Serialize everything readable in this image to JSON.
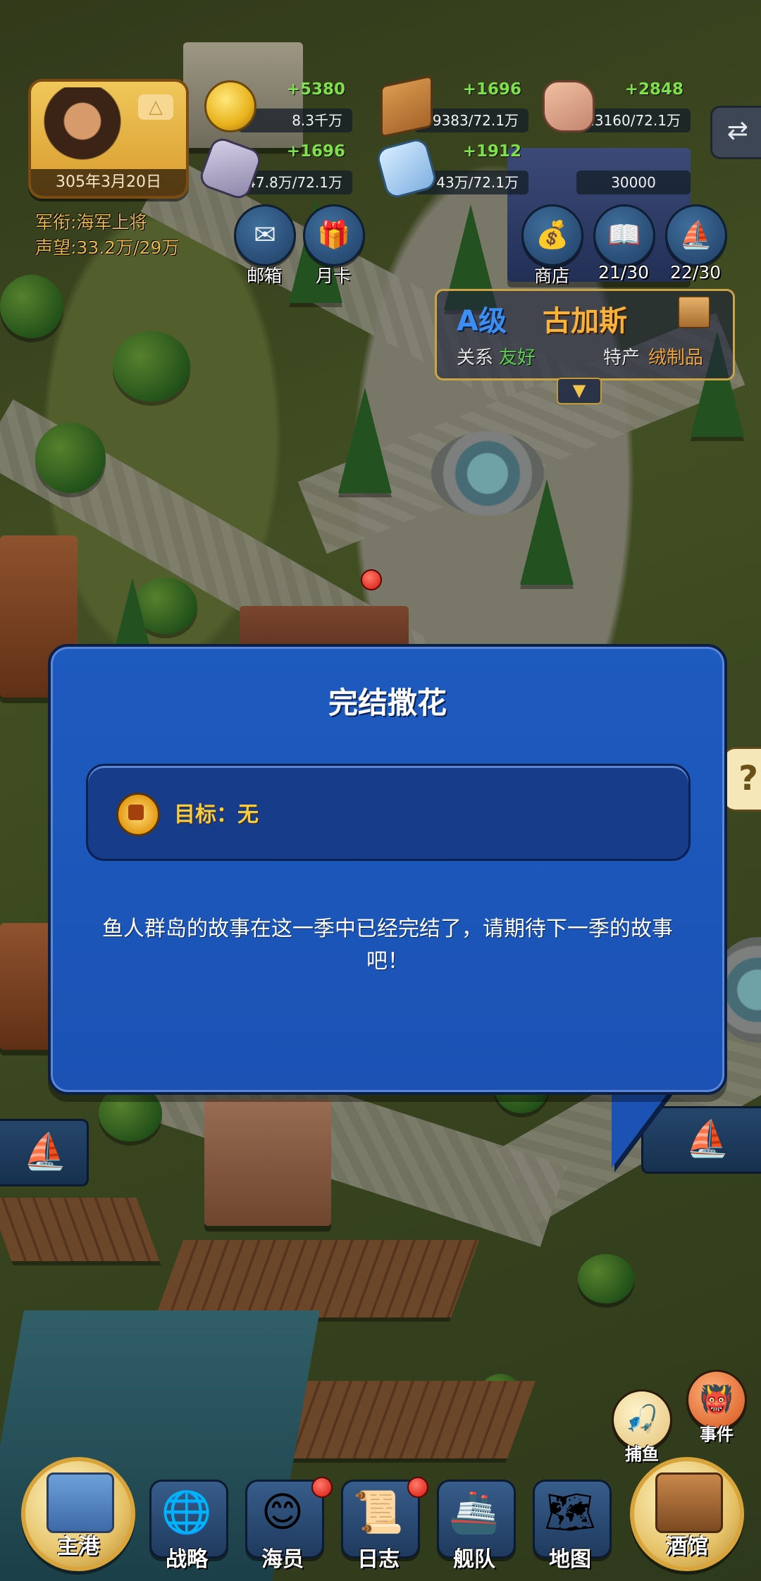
{
  "player": {
    "date": "305年3月20日",
    "rank_line": "军衔:海军上将",
    "fame_line": "声望:33.2万/29万"
  },
  "resources": [
    {
      "name": "gold-coin-icon",
      "delta": "+5380",
      "amount": "8.3千万"
    },
    {
      "name": "wood-icon",
      "delta": "+1696",
      "amount": "19383/72.1万"
    },
    {
      "name": "stone-icon",
      "delta": "+2848",
      "amount": "13160/72.1万"
    },
    {
      "name": "crystal-icon",
      "delta": "+1696",
      "amount": "47.8万/72.1万"
    },
    {
      "name": "ice-ore-icon",
      "delta": "+1912",
      "amount": "43万/72.1万"
    },
    {
      "name": "academy-icon",
      "delta": "",
      "amount": "30000"
    }
  ],
  "hud_buttons": {
    "mail": "邮箱",
    "monthly_card": "月卡",
    "shop": "商店",
    "book_count": "21/30",
    "ship_count": "22/30"
  },
  "town": {
    "grade": "A级",
    "name": "古加斯",
    "relation_label": "关系",
    "relation_value": "友好",
    "specialty_label": "特产",
    "specialty_value": "绒制品"
  },
  "dialog": {
    "title": "完结撒花",
    "goal": "目标：无",
    "body": "鱼人群岛的故事在这一季中已经完结了，请期待下一季的故事吧！"
  },
  "side": {
    "fishing": "捕鱼",
    "event": "事件"
  },
  "nav": {
    "home": "主港",
    "strategy": "战略",
    "crew": "海员",
    "log": "日志",
    "fleet": "舰队",
    "map": "地图",
    "tavern": "酒馆"
  },
  "colors": {
    "dialog_blue": "#1b52b4",
    "goal_yellow": "#f7cc3f",
    "delta_green": "#7ee04b",
    "grade_blue": "#3c8ef2",
    "town_orange": "#f7b23b"
  }
}
